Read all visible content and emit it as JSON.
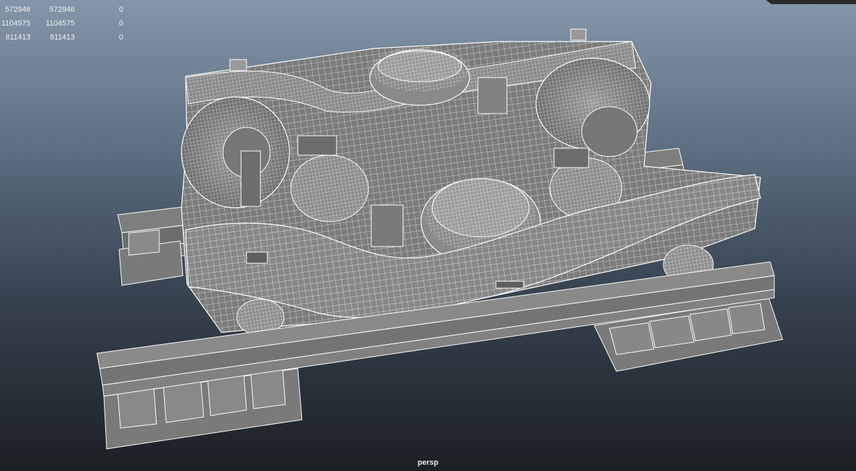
{
  "hud_stats": {
    "rows": [
      [
        "572946",
        "572946",
        "0"
      ],
      [
        "1104575",
        "1104575",
        "0"
      ],
      [
        "811413",
        "811413",
        "0"
      ]
    ]
  },
  "viewport": {
    "camera": "persp",
    "colors": {
      "background_top": "#8596a9",
      "background_bottom": "#1b1f24",
      "surface": "#7b7b7b",
      "wire": "#ffffff"
    }
  }
}
